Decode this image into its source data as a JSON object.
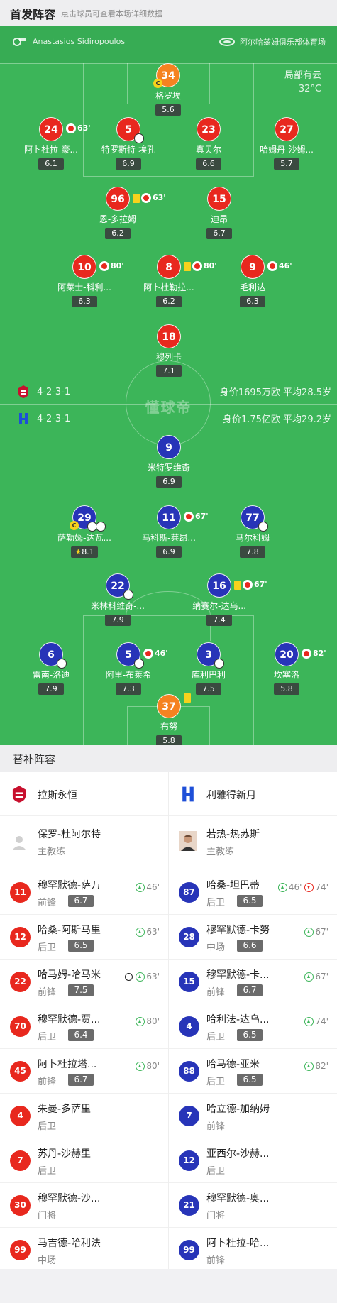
{
  "header": {
    "title": "首发阵容",
    "subtitle": "点击球员可查看本场详细数据"
  },
  "match_info": {
    "referee": "Anastasios Sidiropoulos",
    "venue": "阿尔哈兹姆俱乐部体育场",
    "weather": "局部有云",
    "temperature": "32°C"
  },
  "watermark": "懂球帝",
  "home": {
    "formation": "4-2-3-1",
    "summary": "身价1695万欧 平均28.5岁",
    "players": [
      {
        "num": "34",
        "name": "格罗埃",
        "rating": "5.6",
        "kit": "gk"
      },
      {
        "num": "24",
        "name": "阿卜杜拉-豪...",
        "rating": "6.1",
        "minute": "63'"
      },
      {
        "num": "5",
        "name": "特罗斯特-埃孔",
        "rating": "6.9"
      },
      {
        "num": "23",
        "name": "真贝尔",
        "rating": "6.6"
      },
      {
        "num": "27",
        "name": "哈姆丹-沙姆...",
        "rating": "5.7"
      },
      {
        "num": "96",
        "name": "恩-多拉姆",
        "rating": "6.2",
        "minute": "63'"
      },
      {
        "num": "15",
        "name": "迪昂",
        "rating": "6.7"
      },
      {
        "num": "10",
        "name": "阿莱士-科利...",
        "rating": "6.3",
        "minute": "80'"
      },
      {
        "num": "8",
        "name": "阿卜杜勒拉...",
        "rating": "6.2",
        "minute": "80'"
      },
      {
        "num": "9",
        "name": "毛利达",
        "rating": "6.3",
        "minute": "46'"
      },
      {
        "num": "18",
        "name": "穆列卡",
        "rating": "7.1"
      }
    ]
  },
  "away": {
    "formation": "4-2-3-1",
    "summary": "身价1.75亿欧 平均29.2岁",
    "players": [
      {
        "num": "9",
        "name": "米特罗维奇",
        "rating": "6.9"
      },
      {
        "num": "29",
        "name": "萨勒姆-达瓦...",
        "rating": "8.1"
      },
      {
        "num": "11",
        "name": "马科斯-莱昂...",
        "rating": "6.9",
        "minute": "67'"
      },
      {
        "num": "77",
        "name": "马尔科姆",
        "rating": "7.8"
      },
      {
        "num": "22",
        "name": "米林科维奇-...",
        "rating": "7.9"
      },
      {
        "num": "16",
        "name": "纳赛尔-达乌...",
        "rating": "7.4",
        "minute": "67'"
      },
      {
        "num": "6",
        "name": "雷南-洛迪",
        "rating": "7.9"
      },
      {
        "num": "5",
        "name": "阿里-布莱希",
        "rating": "7.3",
        "minute": "46'"
      },
      {
        "num": "3",
        "name": "库利巴利",
        "rating": "7.5"
      },
      {
        "num": "20",
        "name": "坎塞洛",
        "rating": "5.8",
        "minute": "82'"
      },
      {
        "num": "37",
        "name": "布努",
        "rating": "5.8",
        "kit": "gk"
      }
    ]
  },
  "subs_title": "替补阵容",
  "subs_home": {
    "team": "拉斯永恒",
    "coach": {
      "name": "保罗-杜阿尔特",
      "role": "主教练"
    },
    "players": [
      {
        "num": "11",
        "name": "穆罕默德-萨万",
        "pos": "前锋",
        "rating": "6.7",
        "in": "46'"
      },
      {
        "num": "12",
        "name": "哈桑-阿斯马里",
        "pos": "后卫",
        "rating": "6.5",
        "in": "63'"
      },
      {
        "num": "22",
        "name": "哈马姆-哈马米",
        "pos": "前锋",
        "rating": "7.5",
        "in": "63'",
        "goal": true
      },
      {
        "num": "70",
        "name": "穆罕默德-贾...",
        "pos": "后卫",
        "rating": "6.4",
        "in": "80'"
      },
      {
        "num": "45",
        "name": "阿卜杜拉塔...",
        "pos": "前锋",
        "rating": "6.7",
        "in": "80'"
      },
      {
        "num": "4",
        "name": "朱曼-多萨里",
        "pos": "后卫"
      },
      {
        "num": "7",
        "name": "苏丹-沙赫里",
        "pos": "后卫"
      },
      {
        "num": "30",
        "name": "穆罕默德-沙...",
        "pos": "门将"
      },
      {
        "num": "99",
        "name": "马吉德-哈利法",
        "pos": "中场"
      }
    ]
  },
  "subs_away": {
    "team": "利雅得新月",
    "coach": {
      "name": "若热-热苏斯",
      "role": "主教练"
    },
    "players": [
      {
        "num": "87",
        "name": "哈桑-坦巴蒂",
        "pos": "后卫",
        "rating": "6.5",
        "in": "46'",
        "out": "74'"
      },
      {
        "num": "28",
        "name": "穆罕默德-卡努",
        "pos": "中场",
        "rating": "6.6",
        "in": "67'"
      },
      {
        "num": "15",
        "name": "穆罕默德-卡...",
        "pos": "前锋",
        "rating": "6.7",
        "in": "67'"
      },
      {
        "num": "4",
        "name": "哈利法-达乌...",
        "pos": "后卫",
        "rating": "6.5",
        "in": "74'"
      },
      {
        "num": "88",
        "name": "哈马德-亚米",
        "pos": "后卫",
        "rating": "6.5",
        "in": "82'"
      },
      {
        "num": "7",
        "name": "哈立德-加纳姆",
        "pos": "前锋"
      },
      {
        "num": "12",
        "name": "亚西尔-沙赫...",
        "pos": "后卫"
      },
      {
        "num": "21",
        "name": "穆罕默德-奥...",
        "pos": "门将"
      },
      {
        "num": "99",
        "name": "阿卜杜拉-哈...",
        "pos": "前锋"
      }
    ]
  },
  "colors": {
    "home": "#e8281e",
    "away": "#2734b8",
    "gk": "#f58220",
    "pitch": "#3cb559"
  }
}
